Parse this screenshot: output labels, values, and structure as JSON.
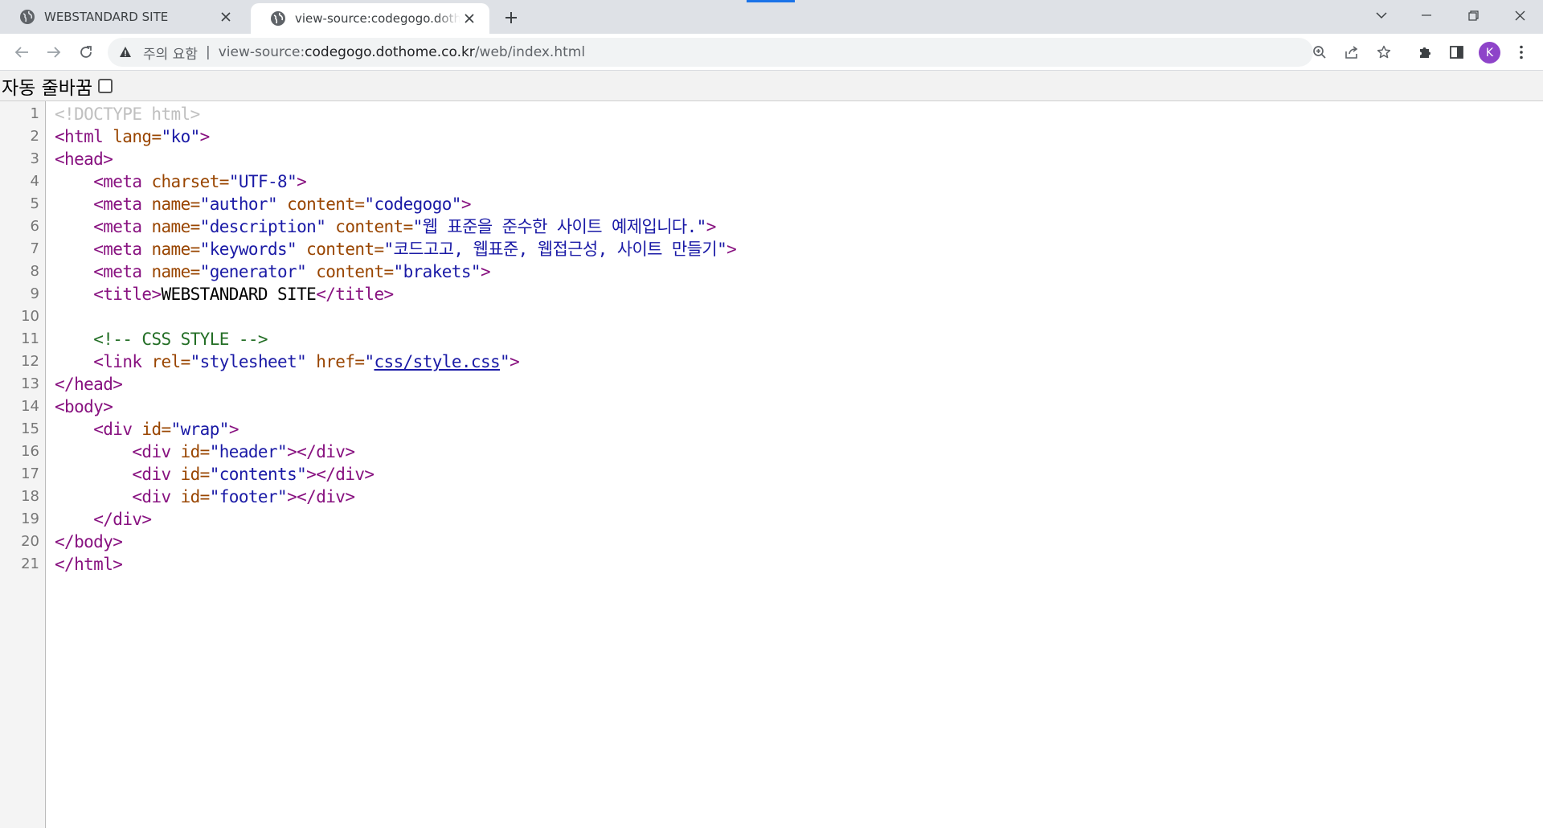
{
  "browser": {
    "tabs": [
      {
        "title": "WEBSTANDARD SITE",
        "active": false
      },
      {
        "title": "view-source:codegogo.dothome.co.kr/web/index.html",
        "active": true
      }
    ],
    "security_warning": "주의 요함",
    "url_separator": "|",
    "url_prefix": "view-source:",
    "url_host": "codegogo.dothome.co.kr",
    "url_path": "/web/index.html",
    "profile_initial": "K",
    "accent_color": "#8e44c9"
  },
  "wrap_toggle": {
    "label": "자동 줄바꿈",
    "checked": false
  },
  "source": {
    "line_numbers": [
      "1",
      "2",
      "3",
      "4",
      "5",
      "6",
      "7",
      "8",
      "9",
      "10",
      "11",
      "12",
      "13",
      "14",
      "15",
      "16",
      "17",
      "18",
      "19",
      "20",
      "21"
    ],
    "lines": [
      [
        {
          "t": "doc",
          "s": "<!DOCTYPE html>"
        }
      ],
      [
        {
          "t": "tag",
          "s": "<html "
        },
        {
          "t": "attr",
          "s": "lang="
        },
        {
          "t": "val",
          "s": "\"ko\""
        },
        {
          "t": "tag",
          "s": ">"
        }
      ],
      [
        {
          "t": "tag",
          "s": "<head>"
        }
      ],
      [
        {
          "t": "sp",
          "s": "    "
        },
        {
          "t": "tag",
          "s": "<meta "
        },
        {
          "t": "attr",
          "s": "charset="
        },
        {
          "t": "val",
          "s": "\"UTF-8\""
        },
        {
          "t": "tag",
          "s": ">"
        }
      ],
      [
        {
          "t": "sp",
          "s": "    "
        },
        {
          "t": "tag",
          "s": "<meta "
        },
        {
          "t": "attr",
          "s": "name="
        },
        {
          "t": "val",
          "s": "\"author\""
        },
        {
          "t": "attr",
          "s": " content="
        },
        {
          "t": "val",
          "s": "\"codegogo\""
        },
        {
          "t": "tag",
          "s": ">"
        }
      ],
      [
        {
          "t": "sp",
          "s": "    "
        },
        {
          "t": "tag",
          "s": "<meta "
        },
        {
          "t": "attr",
          "s": "name="
        },
        {
          "t": "val",
          "s": "\"description\""
        },
        {
          "t": "attr",
          "s": " content="
        },
        {
          "t": "val",
          "s": "\"웹 표준을 준수한 사이트 예제입니다.\""
        },
        {
          "t": "tag",
          "s": ">"
        }
      ],
      [
        {
          "t": "sp",
          "s": "    "
        },
        {
          "t": "tag",
          "s": "<meta "
        },
        {
          "t": "attr",
          "s": "name="
        },
        {
          "t": "val",
          "s": "\"keywords\""
        },
        {
          "t": "attr",
          "s": " content="
        },
        {
          "t": "val",
          "s": "\"코드고고, 웹표준, 웹접근성, 사이트 만들기\""
        },
        {
          "t": "tag",
          "s": ">"
        }
      ],
      [
        {
          "t": "sp",
          "s": "    "
        },
        {
          "t": "tag",
          "s": "<meta "
        },
        {
          "t": "attr",
          "s": "name="
        },
        {
          "t": "val",
          "s": "\"generator\""
        },
        {
          "t": "attr",
          "s": " content="
        },
        {
          "t": "val",
          "s": "\"brakets\""
        },
        {
          "t": "tag",
          "s": ">"
        }
      ],
      [
        {
          "t": "sp",
          "s": "    "
        },
        {
          "t": "tag",
          "s": "<title>"
        },
        {
          "t": "txt",
          "s": "WEBSTANDARD SITE"
        },
        {
          "t": "tag",
          "s": "</title>"
        }
      ],
      [],
      [
        {
          "t": "sp",
          "s": "    "
        },
        {
          "t": "cmt",
          "s": "<!-- CSS STYLE -->"
        }
      ],
      [
        {
          "t": "sp",
          "s": "    "
        },
        {
          "t": "tag",
          "s": "<link "
        },
        {
          "t": "attr",
          "s": "rel="
        },
        {
          "t": "val",
          "s": "\"stylesheet\""
        },
        {
          "t": "attr",
          "s": " href="
        },
        {
          "t": "val",
          "s": "\""
        },
        {
          "t": "lnk",
          "s": "css/style.css"
        },
        {
          "t": "val",
          "s": "\""
        },
        {
          "t": "tag",
          "s": ">"
        }
      ],
      [
        {
          "t": "tag",
          "s": "</head>"
        }
      ],
      [
        {
          "t": "tag",
          "s": "<body>"
        }
      ],
      [
        {
          "t": "sp",
          "s": "    "
        },
        {
          "t": "tag",
          "s": "<div "
        },
        {
          "t": "attr",
          "s": "id="
        },
        {
          "t": "val",
          "s": "\"wrap\""
        },
        {
          "t": "tag",
          "s": ">"
        }
      ],
      [
        {
          "t": "sp",
          "s": "        "
        },
        {
          "t": "tag",
          "s": "<div "
        },
        {
          "t": "attr",
          "s": "id="
        },
        {
          "t": "val",
          "s": "\"header\""
        },
        {
          "t": "tag",
          "s": "></div>"
        }
      ],
      [
        {
          "t": "sp",
          "s": "        "
        },
        {
          "t": "tag",
          "s": "<div "
        },
        {
          "t": "attr",
          "s": "id="
        },
        {
          "t": "val",
          "s": "\"contents\""
        },
        {
          "t": "tag",
          "s": "></div>"
        }
      ],
      [
        {
          "t": "sp",
          "s": "        "
        },
        {
          "t": "tag",
          "s": "<div "
        },
        {
          "t": "attr",
          "s": "id="
        },
        {
          "t": "val",
          "s": "\"footer\""
        },
        {
          "t": "tag",
          "s": "></div>"
        }
      ],
      [
        {
          "t": "sp",
          "s": "    "
        },
        {
          "t": "tag",
          "s": "</div>"
        }
      ],
      [
        {
          "t": "tag",
          "s": "</body>"
        }
      ],
      [
        {
          "t": "tag",
          "s": "</html>"
        }
      ]
    ]
  }
}
